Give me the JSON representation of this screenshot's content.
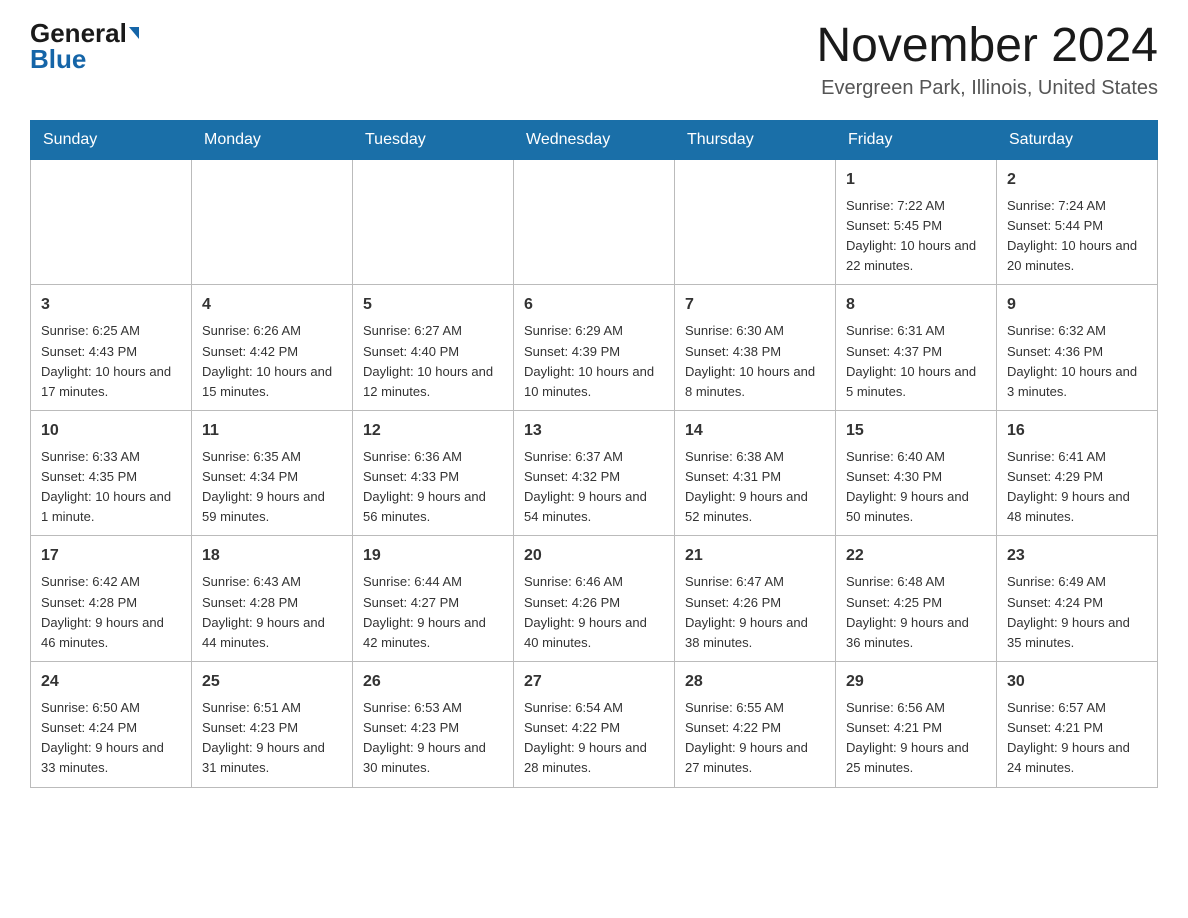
{
  "header": {
    "logo_general": "General",
    "logo_blue": "Blue",
    "month_title": "November 2024",
    "location": "Evergreen Park, Illinois, United States"
  },
  "days_of_week": [
    "Sunday",
    "Monday",
    "Tuesday",
    "Wednesday",
    "Thursday",
    "Friday",
    "Saturday"
  ],
  "weeks": [
    {
      "days": [
        {
          "num": "",
          "info": ""
        },
        {
          "num": "",
          "info": ""
        },
        {
          "num": "",
          "info": ""
        },
        {
          "num": "",
          "info": ""
        },
        {
          "num": "",
          "info": ""
        },
        {
          "num": "1",
          "info": "Sunrise: 7:22 AM\nSunset: 5:45 PM\nDaylight: 10 hours and 22 minutes."
        },
        {
          "num": "2",
          "info": "Sunrise: 7:24 AM\nSunset: 5:44 PM\nDaylight: 10 hours and 20 minutes."
        }
      ]
    },
    {
      "days": [
        {
          "num": "3",
          "info": "Sunrise: 6:25 AM\nSunset: 4:43 PM\nDaylight: 10 hours and 17 minutes."
        },
        {
          "num": "4",
          "info": "Sunrise: 6:26 AM\nSunset: 4:42 PM\nDaylight: 10 hours and 15 minutes."
        },
        {
          "num": "5",
          "info": "Sunrise: 6:27 AM\nSunset: 4:40 PM\nDaylight: 10 hours and 12 minutes."
        },
        {
          "num": "6",
          "info": "Sunrise: 6:29 AM\nSunset: 4:39 PM\nDaylight: 10 hours and 10 minutes."
        },
        {
          "num": "7",
          "info": "Sunrise: 6:30 AM\nSunset: 4:38 PM\nDaylight: 10 hours and 8 minutes."
        },
        {
          "num": "8",
          "info": "Sunrise: 6:31 AM\nSunset: 4:37 PM\nDaylight: 10 hours and 5 minutes."
        },
        {
          "num": "9",
          "info": "Sunrise: 6:32 AM\nSunset: 4:36 PM\nDaylight: 10 hours and 3 minutes."
        }
      ]
    },
    {
      "days": [
        {
          "num": "10",
          "info": "Sunrise: 6:33 AM\nSunset: 4:35 PM\nDaylight: 10 hours and 1 minute."
        },
        {
          "num": "11",
          "info": "Sunrise: 6:35 AM\nSunset: 4:34 PM\nDaylight: 9 hours and 59 minutes."
        },
        {
          "num": "12",
          "info": "Sunrise: 6:36 AM\nSunset: 4:33 PM\nDaylight: 9 hours and 56 minutes."
        },
        {
          "num": "13",
          "info": "Sunrise: 6:37 AM\nSunset: 4:32 PM\nDaylight: 9 hours and 54 minutes."
        },
        {
          "num": "14",
          "info": "Sunrise: 6:38 AM\nSunset: 4:31 PM\nDaylight: 9 hours and 52 minutes."
        },
        {
          "num": "15",
          "info": "Sunrise: 6:40 AM\nSunset: 4:30 PM\nDaylight: 9 hours and 50 minutes."
        },
        {
          "num": "16",
          "info": "Sunrise: 6:41 AM\nSunset: 4:29 PM\nDaylight: 9 hours and 48 minutes."
        }
      ]
    },
    {
      "days": [
        {
          "num": "17",
          "info": "Sunrise: 6:42 AM\nSunset: 4:28 PM\nDaylight: 9 hours and 46 minutes."
        },
        {
          "num": "18",
          "info": "Sunrise: 6:43 AM\nSunset: 4:28 PM\nDaylight: 9 hours and 44 minutes."
        },
        {
          "num": "19",
          "info": "Sunrise: 6:44 AM\nSunset: 4:27 PM\nDaylight: 9 hours and 42 minutes."
        },
        {
          "num": "20",
          "info": "Sunrise: 6:46 AM\nSunset: 4:26 PM\nDaylight: 9 hours and 40 minutes."
        },
        {
          "num": "21",
          "info": "Sunrise: 6:47 AM\nSunset: 4:26 PM\nDaylight: 9 hours and 38 minutes."
        },
        {
          "num": "22",
          "info": "Sunrise: 6:48 AM\nSunset: 4:25 PM\nDaylight: 9 hours and 36 minutes."
        },
        {
          "num": "23",
          "info": "Sunrise: 6:49 AM\nSunset: 4:24 PM\nDaylight: 9 hours and 35 minutes."
        }
      ]
    },
    {
      "days": [
        {
          "num": "24",
          "info": "Sunrise: 6:50 AM\nSunset: 4:24 PM\nDaylight: 9 hours and 33 minutes."
        },
        {
          "num": "25",
          "info": "Sunrise: 6:51 AM\nSunset: 4:23 PM\nDaylight: 9 hours and 31 minutes."
        },
        {
          "num": "26",
          "info": "Sunrise: 6:53 AM\nSunset: 4:23 PM\nDaylight: 9 hours and 30 minutes."
        },
        {
          "num": "27",
          "info": "Sunrise: 6:54 AM\nSunset: 4:22 PM\nDaylight: 9 hours and 28 minutes."
        },
        {
          "num": "28",
          "info": "Sunrise: 6:55 AM\nSunset: 4:22 PM\nDaylight: 9 hours and 27 minutes."
        },
        {
          "num": "29",
          "info": "Sunrise: 6:56 AM\nSunset: 4:21 PM\nDaylight: 9 hours and 25 minutes."
        },
        {
          "num": "30",
          "info": "Sunrise: 6:57 AM\nSunset: 4:21 PM\nDaylight: 9 hours and 24 minutes."
        }
      ]
    }
  ]
}
